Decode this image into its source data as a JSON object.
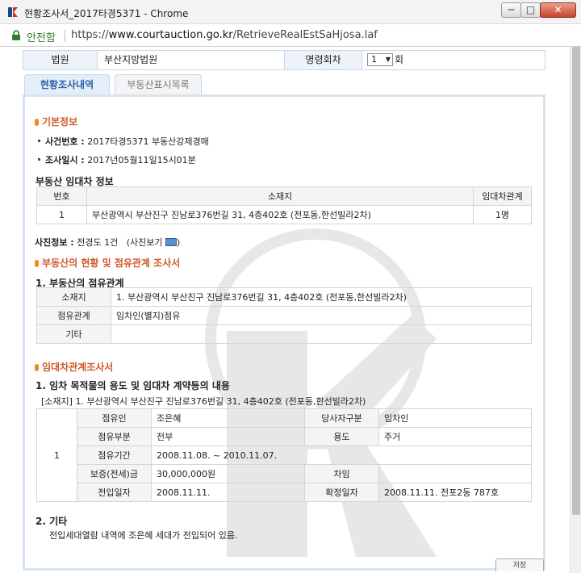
{
  "window": {
    "title": "현황조사서_2017타경5371 - Chrome",
    "controls": {
      "min": "─",
      "max": "□",
      "close": "✕"
    }
  },
  "address": {
    "secure_label": "안전함",
    "url_scheme": "https://",
    "url_host": "www.courtauction.go.kr",
    "url_path": "/RetrieveRealEstSaHjosa.laf"
  },
  "header": {
    "court_label": "법원",
    "court_value": "부산지방법원",
    "order_label": "명령회차",
    "order_value": "1",
    "order_unit": "회"
  },
  "tabs": [
    {
      "label": "현황조사내역",
      "active": true
    },
    {
      "label": "부동산표시목록",
      "active": false
    }
  ],
  "basic": {
    "title": "기본정보",
    "case_key": "사건번호 :",
    "case_value": "2017타경5371 부동산강제경매",
    "date_key": "조사일시 :",
    "date_value": "2017년05월11일15시01분"
  },
  "lease_info": {
    "title": "부동산 임대차 정보",
    "headers": [
      "번호",
      "소재지",
      "임대차관계"
    ],
    "rows": [
      {
        "no": "1",
        "address": "부산광역시 부산진구 진남로376번길 31, 4층402호 (전포동,한선빌라2차)",
        "relation": "1명"
      }
    ]
  },
  "photo": {
    "key": "사진정보 :",
    "value": "전경도 1건",
    "link": "(사진보기",
    "link_end": ")"
  },
  "status": {
    "title": "부동산의 현황 및 점유관계 조사서",
    "subhead": "1. 부동산의 점유관계",
    "rows": [
      {
        "label": "소재지",
        "value": "1. 부산광역시 부산진구 진남로376번길 31, 4층402호 (전포동,한선빌라2차)"
      },
      {
        "label": "점유관계",
        "value": "임차인(별지)점유"
      },
      {
        "label": "기타",
        "value": ""
      }
    ]
  },
  "lease_survey": {
    "title": "임대차관계조사서",
    "subhead": "1. 임차 목적물의 용도 및 임대차 계약등의 내용",
    "location": "[소재지] 1. 부산광역시 부산진구 진남로376번길 31, 4층402호 (전포동,한선빌라2차)",
    "row_no": "1",
    "occupant_label": "점유인",
    "occupant_value": "조은혜",
    "party_label": "당사자구분",
    "party_value": "임차인",
    "part_label": "점유부분",
    "part_value": "전부",
    "use_label": "용도",
    "use_value": "주거",
    "period_label": "점유기간",
    "period_value": "2008.11.08. ~ 2010.11.07.",
    "deposit_label": "보증(전세)금",
    "deposit_value": "30,000,000원",
    "rent_label": "차임",
    "rent_value": "",
    "movein_label": "전입일자",
    "movein_value": "2008.11.11.",
    "fixed_label": "확정일자",
    "fixed_value": "2008.11.11. 전포2동 787호"
  },
  "etc": {
    "subhead": "2. 기타",
    "text": "전입세대열람 내역에 조은혜 세대가 전입되어 있음."
  },
  "footer": {
    "save_label": "저장"
  },
  "colors": {
    "accent_orange": "#d2582a",
    "tab_blue": "#2b63a8",
    "secure_green": "#2e7d32"
  }
}
